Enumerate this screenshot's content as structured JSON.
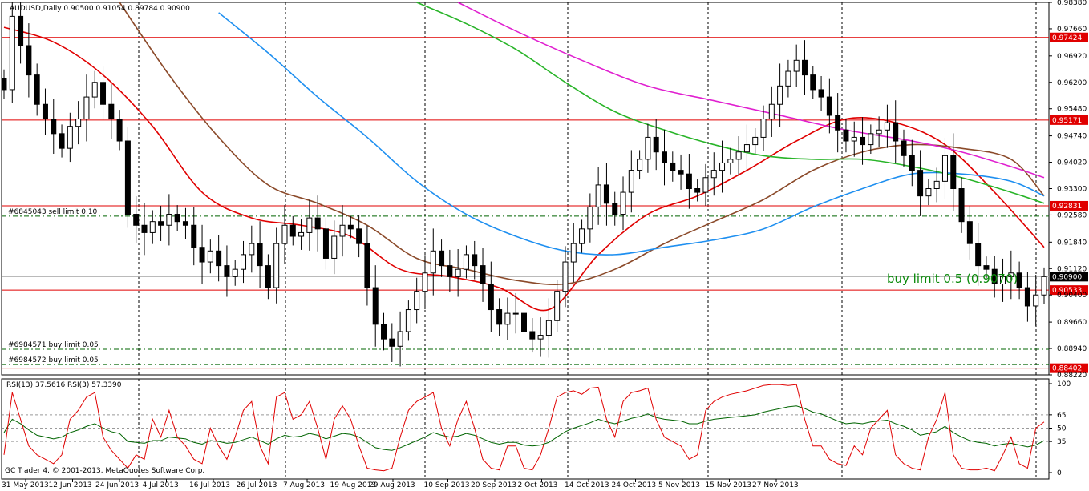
{
  "header": {
    "symbol_line": "AUDUSD,Daily  0.90500 0.91054 0.89784 0.90900",
    "rsi_line": "RSI(13) 37.5616  RSI(3) 57.3390",
    "copyright": "GC Trader 4, © 2001-2013, MetaQuotes Software Corp."
  },
  "annotation": {
    "buy_limit_text": "buy limit 0.5 (0.9070)"
  },
  "colors": {
    "bull_body": "#ffffff",
    "bear_body": "#000000",
    "candle_outline": "#000000",
    "ma_red": "#e00000",
    "ma_brown": "#8b4a2a",
    "ma_blue": "#1e8ff0",
    "ma_green": "#28b428",
    "ma_magenta": "#e020d0",
    "hline_red": "#e00000",
    "order_green": "#006400",
    "rsi13": "#006400",
    "rsi3": "#e00000",
    "annotation": "#0a8a0a"
  },
  "chart_data": [
    {
      "type": "candlestick",
      "title": "AUDUSD,Daily",
      "ylim": [
        0.8822,
        0.9838
      ],
      "y_ticks": [
        "0.98380",
        "0.97660",
        "0.96920",
        "0.96200",
        "0.95480",
        "0.94740",
        "0.94020",
        "0.93300",
        "0.92580",
        "0.91840",
        "0.91120",
        "0.90400",
        "0.89660",
        "0.88940",
        "0.88220"
      ],
      "x_ticks": [
        "31 May 2013",
        "12 Jun 2013",
        "24 Jun 2013",
        "4 Jul 2013",
        "16 Jul 2013",
        "26 Jul 2013",
        "7 Aug 2013",
        "19 Aug 2013",
        "29 Aug 2013",
        "10 Sep 2013",
        "20 Sep 2013",
        "2 Oct 2013",
        "14 Oct 2013",
        "24 Oct 2013",
        "5 Nov 2013",
        "15 Nov 2013",
        "27 Nov 2013"
      ],
      "current_price": "0.90900",
      "close_series": [
        0.96,
        0.98,
        0.972,
        0.964,
        0.956,
        0.952,
        0.948,
        0.944,
        0.95,
        0.952,
        0.958,
        0.962,
        0.956,
        0.952,
        0.946,
        0.926,
        0.923,
        0.921,
        0.924,
        0.923,
        0.926,
        0.924,
        0.923,
        0.917,
        0.913,
        0.916,
        0.912,
        0.909,
        0.911,
        0.915,
        0.918,
        0.912,
        0.906,
        0.918,
        0.923,
        0.92,
        0.921,
        0.925,
        0.922,
        0.914,
        0.92,
        0.923,
        0.922,
        0.918,
        0.906,
        0.896,
        0.892,
        0.89,
        0.894,
        0.9,
        0.905,
        0.91,
        0.916,
        0.912,
        0.909,
        0.911,
        0.915,
        0.912,
        0.907,
        0.9,
        0.896,
        0.899,
        0.899,
        0.894,
        0.892,
        0.893,
        0.897,
        0.905,
        0.913,
        0.918,
        0.922,
        0.928,
        0.934,
        0.929,
        0.926,
        0.932,
        0.938,
        0.941,
        0.947,
        0.943,
        0.94,
        0.938,
        0.937,
        0.933,
        0.932,
        0.936,
        0.938,
        0.94,
        0.941,
        0.943,
        0.945,
        0.947,
        0.952,
        0.956,
        0.961,
        0.965,
        0.968,
        0.964,
        0.96,
        0.958,
        0.953,
        0.949,
        0.946,
        0.947,
        0.945,
        0.948,
        0.949,
        0.951,
        0.946,
        0.942,
        0.938,
        0.931,
        0.933,
        0.935,
        0.942,
        0.933,
        0.924,
        0.918,
        0.912,
        0.911,
        0.907,
        0.909,
        0.91,
        0.906,
        0.901,
        0.904,
        0.909
      ],
      "series": [
        {
          "name": "MA red",
          "points": [
            [
              0,
              0.977
            ],
            [
              6,
              0.973
            ],
            [
              12,
              0.964
            ],
            [
              18,
              0.95
            ],
            [
              24,
              0.932
            ],
            [
              30,
              0.925
            ],
            [
              36,
              0.923
            ],
            [
              42,
              0.92
            ],
            [
              48,
              0.911
            ],
            [
              54,
              0.909
            ],
            [
              60,
              0.906
            ],
            [
              66,
              0.9
            ],
            [
              72,
              0.915
            ],
            [
              78,
              0.926
            ],
            [
              84,
              0.931
            ],
            [
              90,
              0.938
            ],
            [
              96,
              0.946
            ],
            [
              102,
              0.952
            ],
            [
              108,
              0.951
            ],
            [
              114,
              0.945
            ],
            [
              120,
              0.932
            ],
            [
              126,
              0.917
            ]
          ]
        },
        {
          "name": "MA brown",
          "points": [
            [
              14,
              0.9838
            ],
            [
              20,
              0.964
            ],
            [
              26,
              0.947
            ],
            [
              32,
              0.934
            ],
            [
              38,
              0.929
            ],
            [
              44,
              0.923
            ],
            [
              50,
              0.914
            ],
            [
              56,
              0.911
            ],
            [
              62,
              0.908
            ],
            [
              68,
              0.907
            ],
            [
              74,
              0.911
            ],
            [
              80,
              0.918
            ],
            [
              86,
              0.924
            ],
            [
              92,
              0.93
            ],
            [
              98,
              0.938
            ],
            [
              104,
              0.943
            ],
            [
              110,
              0.945
            ],
            [
              116,
              0.944
            ],
            [
              122,
              0.941
            ],
            [
              126,
              0.931
            ]
          ]
        },
        {
          "name": "MA blue",
          "points": [
            [
              26,
              0.981
            ],
            [
              32,
              0.97
            ],
            [
              38,
              0.958
            ],
            [
              44,
              0.947
            ],
            [
              50,
              0.935
            ],
            [
              56,
              0.926
            ],
            [
              62,
              0.92
            ],
            [
              68,
              0.916
            ],
            [
              74,
              0.915
            ],
            [
              80,
              0.917
            ],
            [
              86,
              0.919
            ],
            [
              92,
              0.922
            ],
            [
              98,
              0.928
            ],
            [
              104,
              0.933
            ],
            [
              110,
              0.937
            ],
            [
              116,
              0.937
            ],
            [
              122,
              0.935
            ],
            [
              126,
              0.931
            ]
          ]
        },
        {
          "name": "MA green",
          "points": [
            [
              50,
              0.9838
            ],
            [
              56,
              0.978
            ],
            [
              62,
              0.971
            ],
            [
              68,
              0.962
            ],
            [
              74,
              0.954
            ],
            [
              80,
              0.949
            ],
            [
              86,
              0.945
            ],
            [
              92,
              0.942
            ],
            [
              98,
              0.941
            ],
            [
              104,
              0.941
            ],
            [
              110,
              0.939
            ],
            [
              116,
              0.936
            ],
            [
              122,
              0.932
            ],
            [
              126,
              0.929
            ]
          ]
        },
        {
          "name": "MA magenta",
          "points": [
            [
              55,
              0.9838
            ],
            [
              62,
              0.976
            ],
            [
              70,
              0.968
            ],
            [
              78,
              0.961
            ],
            [
              86,
              0.957
            ],
            [
              94,
              0.953
            ],
            [
              102,
              0.949
            ],
            [
              110,
              0.946
            ],
            [
              116,
              0.943
            ],
            [
              122,
              0.939
            ],
            [
              126,
              0.936
            ]
          ]
        }
      ],
      "horizontal_lines": [
        {
          "value": "0.97424",
          "color": "#e00000",
          "style": "solid"
        },
        {
          "value": "0.95171",
          "color": "#e00000",
          "style": "solid"
        },
        {
          "value": "0.92831",
          "color": "#e00000",
          "style": "solid"
        },
        {
          "value": "0.90533",
          "color": "#e00000",
          "style": "solid"
        },
        {
          "value": "0.88402",
          "color": "#e00000",
          "style": "solid"
        }
      ],
      "pending_orders": [
        {
          "label": "#6845043 sell limit 0.10",
          "value": 0.9255
        },
        {
          "label": "#6984571 buy limit 0.05",
          "value": 0.8892
        },
        {
          "label": "#6984572 buy limit 0.05",
          "value": 0.885
        }
      ]
    },
    {
      "type": "line",
      "title": "RSI(13) 37.5616  RSI(3) 57.3390",
      "ylim": [
        0,
        100
      ],
      "y_ticks": [
        "100",
        "65",
        "50",
        "35",
        "0"
      ],
      "levels": [
        65,
        50,
        35
      ],
      "series": [
        {
          "name": "RSI(13)",
          "values": [
            45,
            60,
            55,
            48,
            42,
            40,
            38,
            40,
            45,
            48,
            52,
            55,
            50,
            46,
            44,
            35,
            34,
            33,
            36,
            36,
            40,
            39,
            38,
            34,
            32,
            36,
            35,
            33,
            34,
            37,
            40,
            36,
            32,
            38,
            42,
            40,
            41,
            44,
            42,
            38,
            41,
            44,
            43,
            40,
            34,
            28,
            26,
            25,
            28,
            32,
            36,
            40,
            45,
            42,
            40,
            41,
            44,
            42,
            38,
            34,
            32,
            34,
            34,
            31,
            30,
            31,
            34,
            40,
            46,
            50,
            53,
            56,
            60,
            57,
            55,
            58,
            61,
            63,
            66,
            62,
            60,
            59,
            58,
            55,
            55,
            58,
            60,
            61,
            62,
            63,
            64,
            65,
            68,
            70,
            72,
            74,
            75,
            72,
            68,
            66,
            62,
            58,
            55,
            56,
            55,
            57,
            58,
            59,
            55,
            52,
            48,
            42,
            44,
            46,
            52,
            45,
            40,
            36,
            34,
            33,
            30,
            32,
            33,
            31,
            29,
            31,
            36
          ]
        },
        {
          "name": "RSI(3)",
          "values": [
            20,
            90,
            60,
            30,
            20,
            15,
            10,
            20,
            60,
            70,
            85,
            90,
            40,
            25,
            15,
            5,
            20,
            15,
            60,
            40,
            70,
            40,
            30,
            15,
            10,
            50,
            30,
            15,
            40,
            70,
            80,
            30,
            10,
            85,
            90,
            60,
            65,
            80,
            50,
            15,
            60,
            75,
            60,
            30,
            5,
            3,
            2,
            5,
            40,
            70,
            80,
            85,
            90,
            50,
            30,
            60,
            80,
            50,
            15,
            5,
            3,
            30,
            30,
            5,
            3,
            20,
            50,
            85,
            90,
            92,
            88,
            95,
            96,
            60,
            40,
            80,
            90,
            92,
            95,
            60,
            40,
            35,
            30,
            15,
            20,
            70,
            80,
            85,
            88,
            90,
            92,
            95,
            98,
            99,
            99,
            98,
            99,
            60,
            30,
            30,
            15,
            10,
            8,
            30,
            20,
            50,
            60,
            70,
            20,
            10,
            5,
            3,
            40,
            60,
            90,
            20,
            5,
            3,
            3,
            5,
            2,
            20,
            40,
            10,
            5,
            50,
            57
          ]
        }
      ]
    }
  ]
}
